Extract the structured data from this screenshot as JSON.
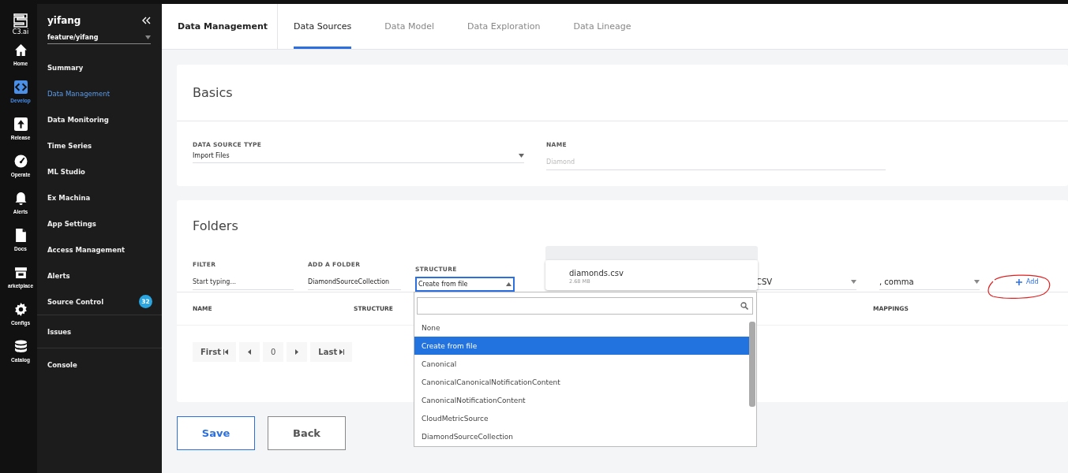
{
  "rail": {
    "logo": "C3.ai",
    "items": [
      {
        "label": "Home",
        "kind": "home",
        "selected": false
      },
      {
        "label": "Develop",
        "kind": "code",
        "selected": true
      },
      {
        "label": "Release",
        "kind": "upload",
        "selected": false
      },
      {
        "label": "Operate",
        "kind": "gauge",
        "selected": false
      },
      {
        "label": "Alerts",
        "kind": "bell",
        "selected": false
      },
      {
        "label": "Docs",
        "kind": "doc",
        "selected": false
      },
      {
        "label": "arketplace",
        "kind": "store",
        "selected": false
      },
      {
        "label": "Configs",
        "kind": "gear",
        "selected": false
      },
      {
        "label": "Catalog",
        "kind": "db",
        "selected": false
      }
    ]
  },
  "sidebar": {
    "title": "yifang",
    "branch": "feature/yifang",
    "items": [
      {
        "label": "Summary",
        "selected": false,
        "divider_before": false
      },
      {
        "label": "Data Management",
        "selected": true,
        "divider_before": false
      },
      {
        "label": "Data Monitoring",
        "selected": false,
        "divider_before": false
      },
      {
        "label": "Time Series",
        "selected": false,
        "divider_before": false
      },
      {
        "label": "ML Studio",
        "selected": false,
        "divider_before": false
      },
      {
        "label": "Ex Machina",
        "selected": false,
        "divider_before": false
      },
      {
        "label": "App Settings",
        "selected": false,
        "divider_before": false
      },
      {
        "label": "Access Management",
        "selected": false,
        "divider_before": false
      },
      {
        "label": "Alerts",
        "selected": false,
        "divider_before": false
      },
      {
        "label": "Source Control",
        "selected": false,
        "divider_before": false,
        "badge": "32"
      },
      {
        "label": "Issues",
        "selected": false,
        "divider_before": true
      },
      {
        "label": "Console",
        "selected": false,
        "divider_before": true
      }
    ]
  },
  "header": {
    "title": "Data Management",
    "tabs": [
      {
        "label": "Data Sources",
        "selected": true
      },
      {
        "label": "Data Model",
        "selected": false
      },
      {
        "label": "Data Exploration",
        "selected": false
      },
      {
        "label": "Data Lineage",
        "selected": false
      }
    ]
  },
  "basics": {
    "title": "Basics",
    "type_field": {
      "label": "DATA SOURCE TYPE",
      "value": "Import Files"
    },
    "name_field": {
      "label": "NAME",
      "placeholder": "Diamond"
    }
  },
  "folders": {
    "title": "Folders",
    "filter": {
      "label": "FILTER",
      "placeholder": "Start typing..."
    },
    "add_folder": {
      "label": "ADD A FOLDER",
      "value": "DiamondSourceCollection"
    },
    "structure": {
      "label": "STRUCTURE",
      "value": "Create from file",
      "open": true
    },
    "format": {
      "value": "CSV"
    },
    "delimiter": {
      "value": ", comma"
    },
    "add_button": "Add",
    "columns": [
      "NAME",
      "STRUCTURE",
      "MAPPINGS"
    ],
    "pagination": {
      "first": "First",
      "page": "0",
      "last": "Last"
    }
  },
  "file_popover": {
    "name": "diamonds.csv",
    "size": "2.68 MB"
  },
  "structure_options": [
    {
      "label": "None",
      "selected": false
    },
    {
      "label": "Create from file",
      "selected": true
    },
    {
      "label": "Canonical",
      "selected": false
    },
    {
      "label": "CanonicalCanonicalNotificationContent",
      "selected": false
    },
    {
      "label": "CanonicalNotificationContent",
      "selected": false
    },
    {
      "label": "CloudMetricSource",
      "selected": false
    },
    {
      "label": "DiamondSourceCollection",
      "selected": false
    }
  ],
  "buttons": [
    "Save",
    "Back"
  ]
}
